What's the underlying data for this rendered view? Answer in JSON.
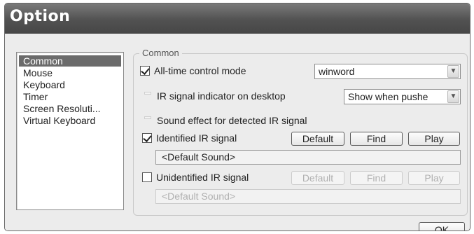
{
  "window": {
    "title": "Option"
  },
  "nav": {
    "items": [
      {
        "label": "Common",
        "selected": true
      },
      {
        "label": "Mouse"
      },
      {
        "label": "Keyboard"
      },
      {
        "label": "Timer"
      },
      {
        "label": "Screen Resoluti..."
      },
      {
        "label": "Virtual Keyboard"
      }
    ]
  },
  "common": {
    "legend": "Common",
    "alltime": {
      "label": "All-time control mode",
      "checked": true,
      "select_value": "winword"
    },
    "indicator": {
      "label": "IR signal indicator on desktop",
      "select_value": "Show when pushe"
    },
    "sound_effect": {
      "label": "Sound effect for detected IR signal"
    },
    "identified": {
      "label": "Identified IR signal",
      "checked": true,
      "default_label": "Default",
      "find_label": "Find",
      "play_label": "Play",
      "sound_value": "<Default Sound>"
    },
    "unidentified": {
      "label": "Unidentified IR signal",
      "checked": false,
      "default_label": "Default",
      "find_label": "Find",
      "play_label": "Play",
      "sound_value": "<Default Sound>"
    }
  },
  "footer": {
    "ok_label": "OK"
  }
}
